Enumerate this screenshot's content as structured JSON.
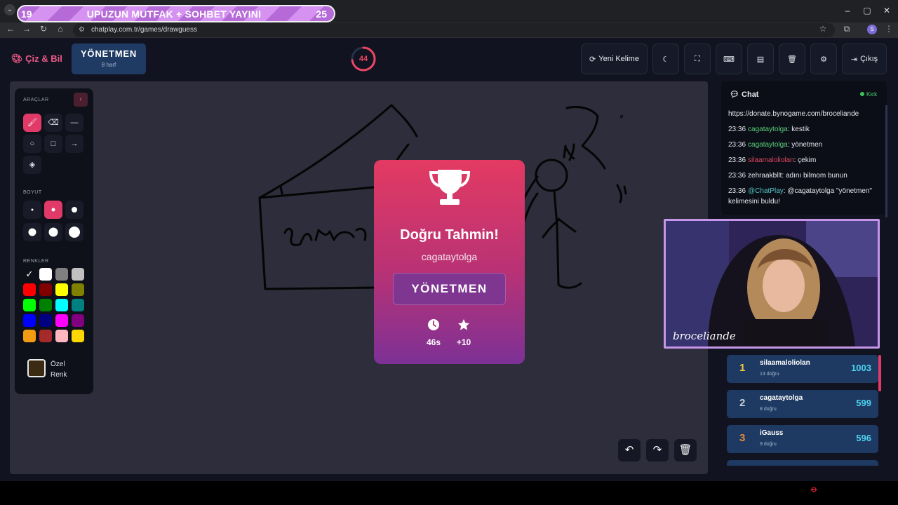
{
  "browser": {
    "banner_left": "19",
    "banner_title": "UPUZUN MUTFAK + SOHBET YAYINI",
    "banner_right": "25",
    "url": "chatplay.com.tr/games/drawguess",
    "profile_initial": "S"
  },
  "header": {
    "logo": "Çiz & Bil",
    "word": "YÖNETMEN",
    "word_hint": "8 harf",
    "timer_value": "44",
    "timer_remaining_fraction": 0.73,
    "buttons": {
      "new_word": "Yeni Kelime",
      "exit": "Çıkış"
    }
  },
  "tools": {
    "section_tools": "ARAÇLAR",
    "section_size": "BOYUT",
    "section_colors": "RENKLER",
    "custom_color_line1": "Özel",
    "custom_color_line2": "Renk",
    "colors": [
      "#000000",
      "#ffffff",
      "#808080",
      "#c0c0c0",
      "#ff0000",
      "#800000",
      "#ffff00",
      "#808000",
      "#00ff00",
      "#008000",
      "#00ffff",
      "#008080",
      "#0000ff",
      "#000080",
      "#ff00ff",
      "#800080",
      "#f39c12",
      "#a52a2a",
      "#ffb6c1",
      "#ffd700"
    ]
  },
  "result": {
    "title": "Doğru Tahmin!",
    "user": "cagataytolga",
    "word": "YÖNETMEN",
    "time": "46s",
    "points": "+10"
  },
  "chat": {
    "title": "Chat",
    "platform": "Kick",
    "messages": [
      {
        "time": "",
        "user": "",
        "text": "https://donate.bynogame.com/broceliande"
      },
      {
        "time": "23:36",
        "user": "cagataytolga",
        "text": ": kestik"
      },
      {
        "time": "23:36",
        "user": "cagataytolga",
        "text": ": yönetmen"
      },
      {
        "time": "23:36",
        "user": "silaamaloliolan",
        "text": ": çekim"
      },
      {
        "time": "23:36",
        "user": "zehraakbllt",
        "text": ": adını bilmom bunun"
      },
      {
        "time": "23:36",
        "user": "@ChatPlay",
        "text": ": @cagataytolga \"yönetmen\" kelimesini buldu!"
      }
    ]
  },
  "webcam": {
    "signature": "broceliande"
  },
  "leaderboard": [
    {
      "rank": "1",
      "name": "silaamaloliolan",
      "sub": "13 doğru",
      "score": "1003"
    },
    {
      "rank": "2",
      "name": "cagataytolga",
      "sub": "8 doğru",
      "score": "599"
    },
    {
      "rank": "3",
      "name": "iGauss",
      "sub": "9 doğru",
      "score": "596"
    }
  ]
}
